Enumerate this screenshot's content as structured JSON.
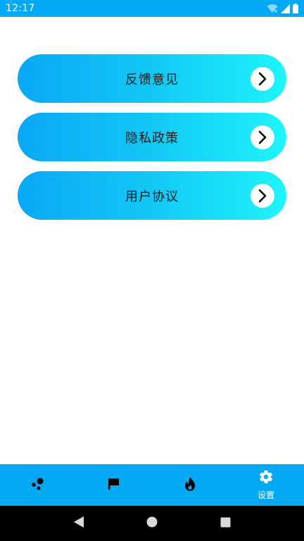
{
  "status_bar": {
    "time": "12:17",
    "icons": [
      "wifi-icon",
      "signal-icon",
      "battery-icon"
    ]
  },
  "menu": {
    "items": [
      {
        "label": "反馈意见",
        "icon": "chevron-right-icon"
      },
      {
        "label": "隐私政策",
        "icon": "chevron-right-icon"
      },
      {
        "label": "用户协议",
        "icon": "chevron-right-icon"
      }
    ]
  },
  "bottom_nav": {
    "items": [
      {
        "icon": "dots-icon",
        "label": ""
      },
      {
        "icon": "flag-icon",
        "label": ""
      },
      {
        "icon": "flame-icon",
        "label": ""
      },
      {
        "icon": "gear-icon",
        "label": "设置"
      }
    ],
    "active_index": 3
  },
  "system_nav": {
    "buttons": [
      "back-icon",
      "home-icon",
      "recents-icon"
    ]
  },
  "colors": {
    "accent": "#03a9f4",
    "gradient_start": "#0aa7f5",
    "gradient_end": "#1ef4fa",
    "background": "#ffffff"
  }
}
